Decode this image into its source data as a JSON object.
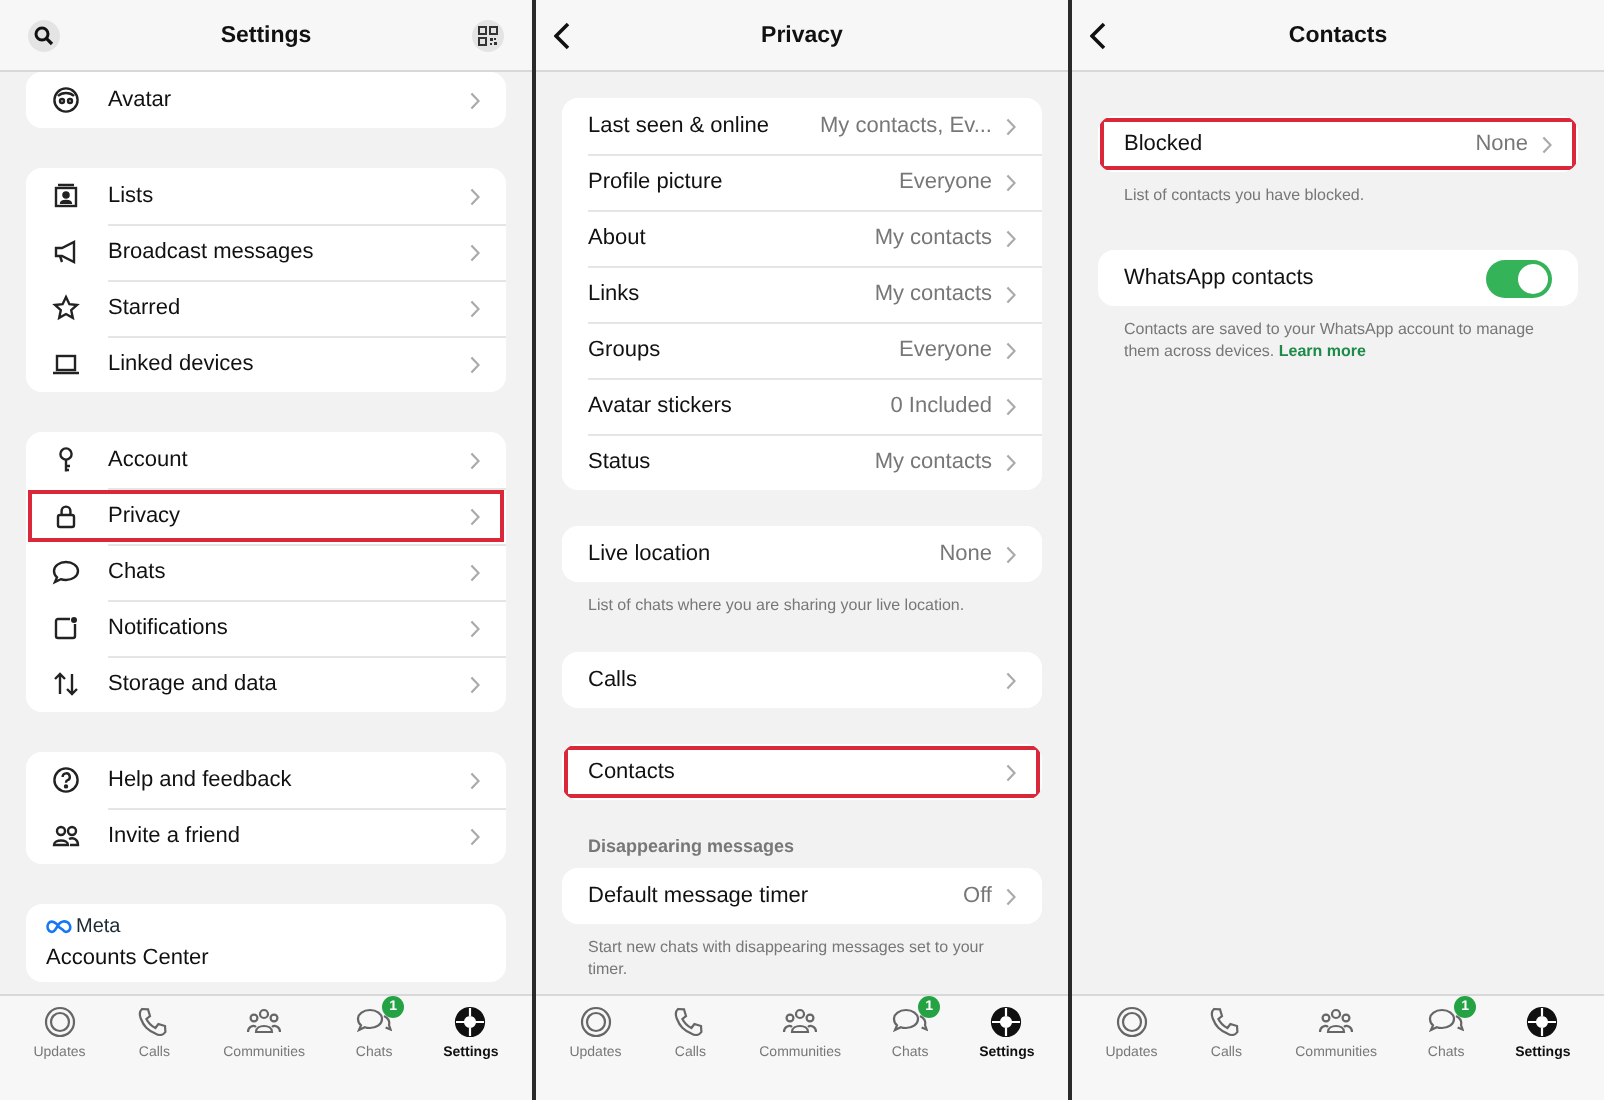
{
  "screens": [
    {
      "kind": "settings",
      "header": {
        "title": "Settings",
        "back": false
      },
      "sections": [
        {
          "rows": [
            {
              "label": "Avatar",
              "highlighted": false
            }
          ]
        },
        {
          "rows": [
            {
              "label": "Lists",
              "highlighted": false
            },
            {
              "label": "Broadcast messages",
              "highlighted": false
            },
            {
              "label": "Starred",
              "highlighted": false
            },
            {
              "label": "Linked devices",
              "highlighted": false
            }
          ]
        },
        {
          "rows": [
            {
              "label": "Account",
              "highlighted": false
            },
            {
              "label": "Privacy",
              "highlighted": true
            },
            {
              "label": "Chats",
              "highlighted": false
            },
            {
              "label": "Notifications",
              "highlighted": false
            },
            {
              "label": "Storage and data",
              "highlighted": false
            }
          ]
        },
        {
          "rows": [
            {
              "label": "Help and feedback",
              "highlighted": false
            },
            {
              "label": "Invite a friend",
              "highlighted": false
            }
          ]
        }
      ],
      "meta_card": {
        "brand": "Meta",
        "title": "Accounts Center"
      },
      "tab_bar": [
        {
          "label": "Updates",
          "selected": false
        },
        {
          "label": "Calls",
          "selected": false
        },
        {
          "label": "Communities",
          "selected": false
        },
        {
          "label": "Chats",
          "selected": false,
          "badge": "1"
        },
        {
          "label": "Settings",
          "selected": true
        }
      ]
    },
    {
      "kind": "privacy",
      "header": {
        "title": "Privacy",
        "back": true
      },
      "sections": [
        {
          "rows": [
            {
              "label": "Last seen & online",
              "value": "My contacts, Ev...",
              "highlighted": false
            },
            {
              "label": "Profile picture",
              "value": "Everyone",
              "highlighted": false
            },
            {
              "label": "About",
              "value": "My contacts",
              "highlighted": false
            },
            {
              "label": "Links",
              "value": "My contacts",
              "highlighted": false
            },
            {
              "label": "Groups",
              "value": "Everyone",
              "highlighted": false
            },
            {
              "label": "Avatar stickers",
              "value": "0 Included",
              "highlighted": false
            },
            {
              "label": "Status",
              "value": "My contacts",
              "highlighted": false
            }
          ]
        },
        {
          "rows": [
            {
              "label": "Live location",
              "value": "None",
              "highlighted": false
            }
          ],
          "note": {
            "text": "List of chats where you are sharing your live location."
          }
        },
        {
          "rows": [
            {
              "label": "Calls",
              "highlighted": false
            }
          ]
        },
        {
          "rows": [
            {
              "label": "Contacts",
              "highlighted": true
            }
          ]
        },
        {
          "heading": "Disappearing messages",
          "rows": [
            {
              "label": "Default message timer",
              "value": "Off",
              "highlighted": false
            }
          ],
          "note": {
            "text": "Start new chats with disappearing messages set to your timer."
          }
        }
      ],
      "tab_bar": [
        {
          "label": "Updates",
          "selected": false
        },
        {
          "label": "Calls",
          "selected": false
        },
        {
          "label": "Communities",
          "selected": false
        },
        {
          "label": "Chats",
          "selected": false,
          "badge": "1"
        },
        {
          "label": "Settings",
          "selected": true
        }
      ]
    },
    {
      "kind": "contacts",
      "header": {
        "title": "Contacts",
        "back": true
      },
      "sections": [
        {
          "rows": [
            {
              "label": "Blocked",
              "value": "None",
              "highlighted": true
            }
          ],
          "note": {
            "text": "List of contacts you have blocked."
          }
        },
        {
          "rows": [
            {
              "kind": "toggle",
              "label": "WhatsApp contacts",
              "on": true
            }
          ],
          "note": {
            "text": "Contacts are saved to your WhatsApp account to manage them across devices.",
            "link": "Learn more"
          }
        }
      ],
      "tab_bar": [
        {
          "label": "Updates",
          "selected": false
        },
        {
          "label": "Calls",
          "selected": false
        },
        {
          "label": "Communities",
          "selected": false
        },
        {
          "label": "Chats",
          "selected": false,
          "badge": "1"
        },
        {
          "label": "Settings",
          "selected": true
        }
      ]
    }
  ]
}
